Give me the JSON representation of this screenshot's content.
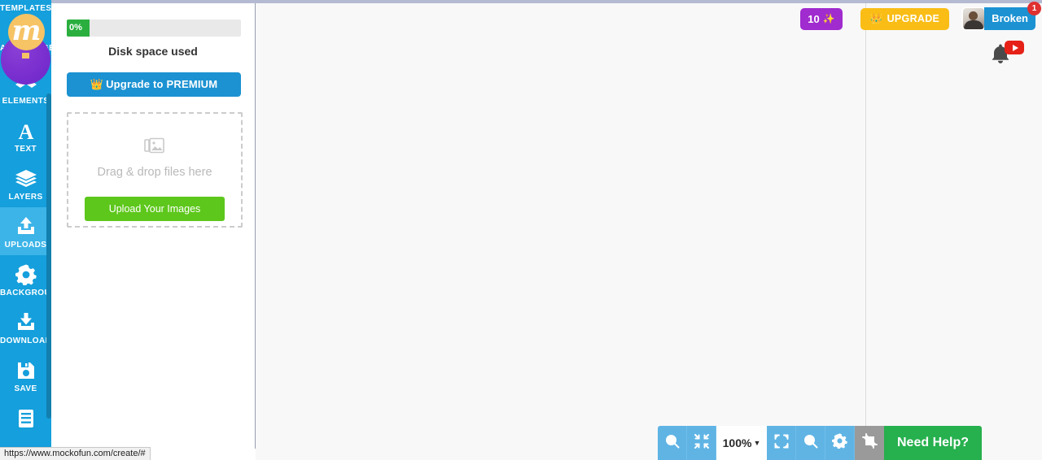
{
  "app": {
    "name": "MockoFun",
    "logo_letter": "m"
  },
  "sidebar": {
    "items": [
      {
        "label": "TEMPLATES",
        "icon": "templates-icon",
        "active": false
      },
      {
        "label": "AI IMAGE GENERATOR",
        "icon": "ai-image-generator-icon",
        "active": false
      },
      {
        "label": "ELEMENTS",
        "icon": "elements-icon",
        "active": false
      },
      {
        "label": "TEXT",
        "icon": "text-icon",
        "active": false
      },
      {
        "label": "LAYERS",
        "icon": "layers-icon",
        "active": false
      },
      {
        "label": "UPLOADS",
        "icon": "uploads-icon",
        "active": true
      },
      {
        "label": "BACKGROUN",
        "icon": "background-gear-icon",
        "active": false
      },
      {
        "label": "DOWNLOAD",
        "icon": "download-icon",
        "active": false
      },
      {
        "label": "SAVE",
        "icon": "save-disk-icon",
        "active": false
      },
      {
        "label": "",
        "icon": "pages-icon",
        "active": false
      }
    ]
  },
  "panel": {
    "disk": {
      "percent_label": "0%",
      "percent_value": 0,
      "caption": "Disk space used",
      "fill_color": "#2aaf3f"
    },
    "premium_button": {
      "label": "Upgrade to PREMIUM",
      "icon": "crown-icon",
      "color": "#1c92d2"
    },
    "dropzone": {
      "icon": "images-icon",
      "text": "Drag & drop files here",
      "upload_button": "Upload Your Images",
      "upload_color": "#5dc71b"
    }
  },
  "topbar": {
    "credits": {
      "count": "10",
      "icon": "sparkles-icon",
      "color": "#a02bce"
    },
    "upgrade": {
      "label": "UPGRADE",
      "icon": "crown-icon",
      "color": "#f9bd16"
    },
    "user": {
      "name": "Broken",
      "notification_count": "1",
      "avatar": "user-avatar"
    },
    "notification": {
      "icon": "bell-icon",
      "badge_icon": "youtube-play-icon"
    }
  },
  "toolbar": {
    "zoom_out": "zoom-out-icon",
    "fit": "fit-screen-icon",
    "zoom_level": "100%",
    "zoom_caret": "▼",
    "fullscreen": "fullscreen-icon",
    "zoom_in": "zoom-in-icon",
    "settings": "gear-icon",
    "crop": "crop-icon",
    "help_label": "Need Help?",
    "help_color": "#27b04e"
  },
  "statusbar": {
    "url": "https://www.mockofun.com/create/#"
  }
}
